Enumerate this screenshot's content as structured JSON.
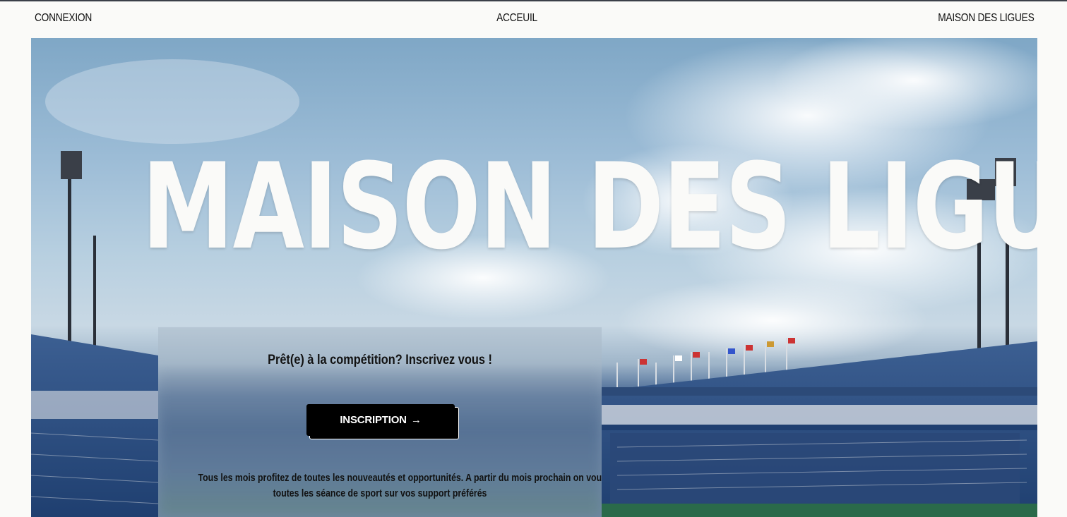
{
  "nav": {
    "left_label": "CONNEXION",
    "center_label": "ACCEUIL",
    "right_label": "MAISON DES LIGUES"
  },
  "hero": {
    "title": "MAISON DES LIGUES"
  },
  "panel": {
    "heading": "Prêt(e) à la compétition? Inscrivez vous !",
    "button_label": "INSCRIPTION",
    "button_arrow": "→",
    "text_line1": "Tous les mois profitez de toutes les nouveautés et opportunités. A partir du mois prochain on vous propose",
    "text_line2": "toutes les séance de sport sur vos support préférés"
  }
}
